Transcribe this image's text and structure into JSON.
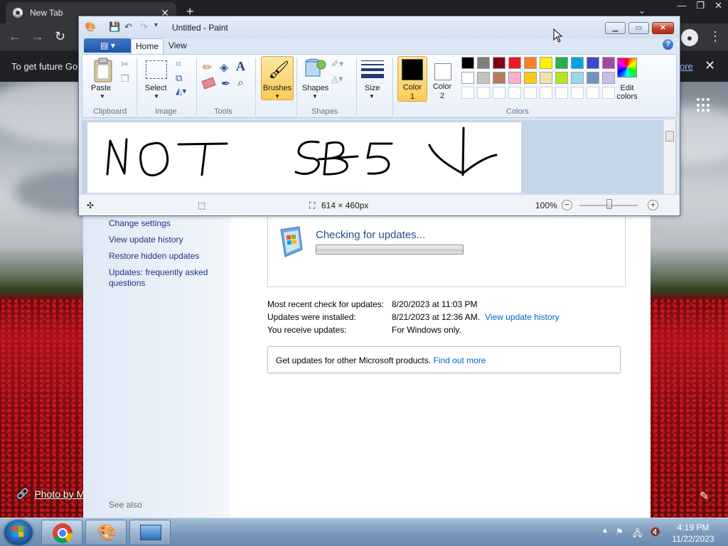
{
  "chrome": {
    "tab_title": "New Tab",
    "infobar_text": "To get future Go",
    "infobar_link": "ore",
    "photo_credit": "Photo by M"
  },
  "paint": {
    "title": "Untitled - Paint",
    "tabs": {
      "home": "Home",
      "view": "View"
    },
    "groups": {
      "clipboard": "Clipboard",
      "image": "Image",
      "tools": "Tools",
      "shapes": "Shapes",
      "colors": "Colors"
    },
    "buttons": {
      "paste": "Paste",
      "select": "Select",
      "brushes": "Brushes",
      "shapes": "Shapes",
      "size": "Size",
      "color1_line1": "Color",
      "color1_line2": "1",
      "color2_line1": "Color",
      "color2_line2": "2",
      "edit_colors_line1": "Edit",
      "edit_colors_line2": "colors"
    },
    "palette_row1": [
      "#000000",
      "#7f7f7f",
      "#880015",
      "#ed1c24",
      "#ff7f27",
      "#fff200",
      "#22b14c",
      "#00a2e8",
      "#3f48cc",
      "#a349a4"
    ],
    "palette_row2": [
      "#ffffff",
      "#c3c3c3",
      "#b97a57",
      "#ffaec9",
      "#ffc90e",
      "#efe4b0",
      "#b5e61d",
      "#99d9ea",
      "#7092be",
      "#c8bfe7"
    ],
    "color1": "#000000",
    "color2": "#ffffff",
    "canvas_text": "NOT SBS",
    "status": {
      "dimensions": "614 × 460px",
      "zoom": "100%"
    }
  },
  "windows_update": {
    "sidebar": {
      "links": [
        "Change settings",
        "View update history",
        "Restore hidden updates",
        "Updates: frequently asked questions"
      ],
      "see_also": "See also"
    },
    "checking": "Checking for updates...",
    "progress": 0.0,
    "rows": [
      {
        "label": "Most recent check for updates:",
        "value": "8/20/2023 at 11:03 PM",
        "link": ""
      },
      {
        "label": "Updates were installed:",
        "value": "8/21/2023 at 12:36 AM.",
        "link": "View update history"
      },
      {
        "label": "You receive updates:",
        "value": "For Windows only.",
        "link": ""
      }
    ],
    "get_updates_text": "Get updates for other Microsoft products.",
    "get_updates_link": "Find out more"
  },
  "taskbar": {
    "time": "4:19 PM",
    "date": "11/22/2023"
  }
}
